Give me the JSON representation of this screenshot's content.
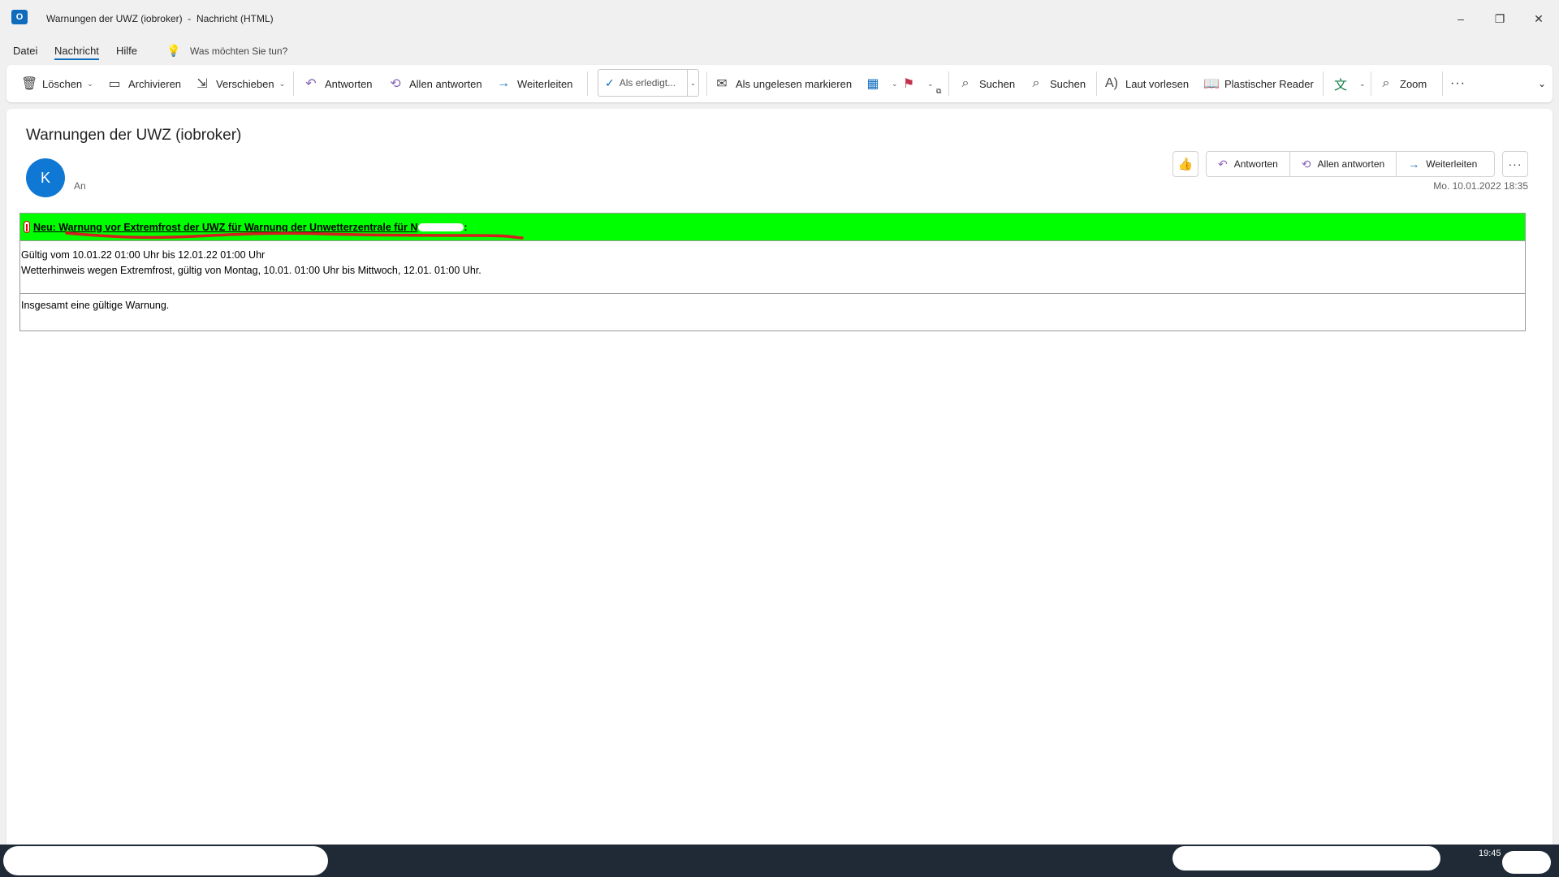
{
  "window": {
    "title": "Warnungen der UWZ (iobroker)  -  Nachricht (HTML)",
    "app_icon": "outlook-icon",
    "minimize": "–",
    "restore": "❐",
    "close": "✕"
  },
  "menu": {
    "items": [
      "Datei",
      "Nachricht",
      "Hilfe"
    ],
    "active": "Nachricht",
    "tell_me": "Was möchten Sie tun?"
  },
  "ribbon": {
    "delete": "Löschen",
    "archive": "Archivieren",
    "move": "Verschieben",
    "reply": "Antworten",
    "reply_all": "Allen antworten",
    "forward": "Weiterleiten",
    "quickstep": "Als erledigt...",
    "mark_unread": "Als ungelesen markieren",
    "find": "Suchen",
    "search": "Suchen",
    "read_aloud": "Laut vorlesen",
    "immersive_reader": "Plastischer Reader",
    "zoom": "Zoom",
    "more": "···"
  },
  "message": {
    "subject": "Warnungen der UWZ (iobroker)",
    "sender_initial": "K",
    "to_label": "An",
    "date": "Mo. 10.01.2022 18:35",
    "actions": {
      "reply": "Antworten",
      "reply_all": "Allen antworten",
      "forward": "Weiterleiten",
      "more": "···"
    }
  },
  "email_body": {
    "header_text": "Neu: Warnung vor Extremfrost der UWZ für Warnung der Unwetterzentrale für N",
    "header_suffix": ":",
    "header_color": "#00ff00",
    "valid_line": "Gültig vom 10.01.22 01:00 Uhr bis 12.01.22 01:00 Uhr",
    "detail_line": "Wetterhinweis wegen Extremfrost, gültig von Montag, 10.01. 01:00 Uhr bis Mittwoch, 12.01. 01:00 Uhr.",
    "total_line": "Insgesamt eine gültige Warnung."
  },
  "taskbar": {
    "clock": "19:45"
  },
  "colors": {
    "accent": "#0f6cbd",
    "annotation": "#d21f1f"
  }
}
